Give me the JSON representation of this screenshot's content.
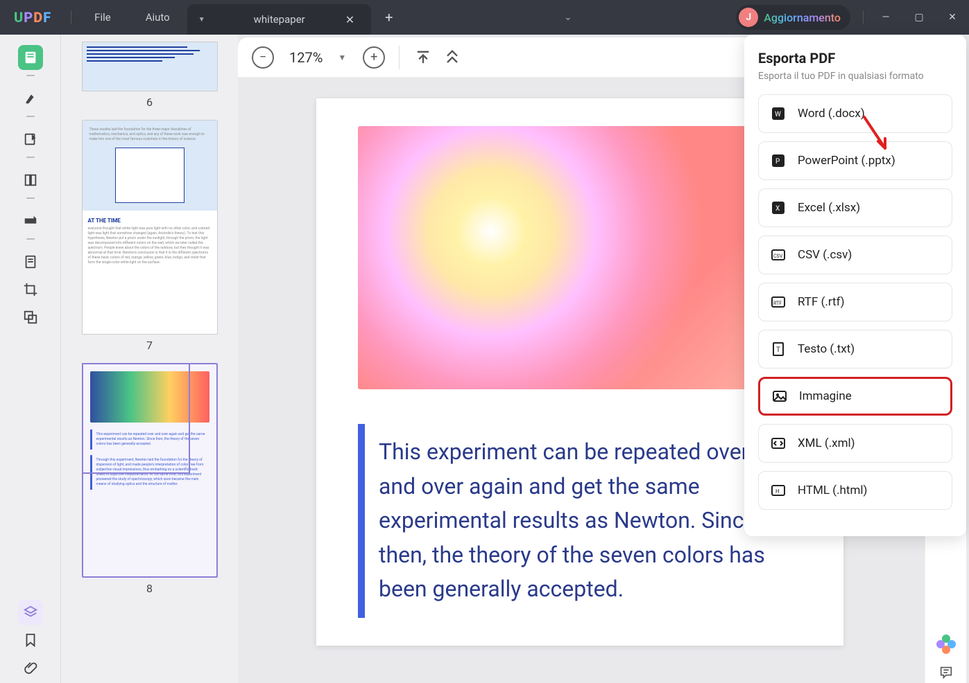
{
  "titlebar": {
    "menu_file": "File",
    "menu_help": "Aiuto",
    "tab_title": "whitepaper",
    "avatar_initial": "J",
    "user_label": "Aggiornamento"
  },
  "toolbar": {
    "zoom": "127%"
  },
  "thumbs": {
    "p6": "6",
    "p7": "7",
    "p8": "8",
    "p7_heading": "AT THE TIME",
    "p7_snippet_top": "These studies laid the foundation for the three major disciplines of mathematics, mechanics, and optics, and any of these work was enough to make him one of the most famous scientists in the history of science.",
    "p7_snippet_body": "everyone thought that white light was pure light with no other color, and colored light was light that somehow changed (again, Aristotle's theory). To test this hypothesis, Newton put a prism under the sunlight; through the prism, the light was decomposed into different colors on the wall, which we later called the spectrum. People knew about the colors of the rainbow, but they thought it was abnormal at that time. Newton's conclusion is that it is the different spectrums of these basic colors of red, orange, yellow, green, blue, indigo, and violet that form the single-color white light on the surface.",
    "p8_box1": "This experiment can be repeated over and over again and get the same experimental results as Newton. Since then, the theory of the seven colors has been generally accepted.",
    "p8_box2": "Through this experiment, Newton laid the foundation for the theory of dispersion of light, and made people's interpretation of color free from subjective visual impressions, thus embarking on a scientific track linked to objective measurements. At the same time, this experiment pioneered the study of spectroscopy, which soon became the main means of studying optics and the structure of matter."
  },
  "page": {
    "quote": "This experiment can be repeated over and over again and get the same experimental results as Newton. Since then, the theory of the seven colors has been generally accepted."
  },
  "export": {
    "title": "Esporta PDF",
    "subtitle": "Esporta il tuo PDF in qualsiasi formato",
    "options": {
      "word": "Word (.docx)",
      "pptx": "PowerPoint (.pptx)",
      "xlsx": "Excel (.xlsx)",
      "csv": "CSV (.csv)",
      "rtf": "RTF (.rtf)",
      "txt": "Testo (.txt)",
      "img": "Immagine",
      "xml": "XML (.xml)",
      "html": "HTML (.html)"
    }
  }
}
